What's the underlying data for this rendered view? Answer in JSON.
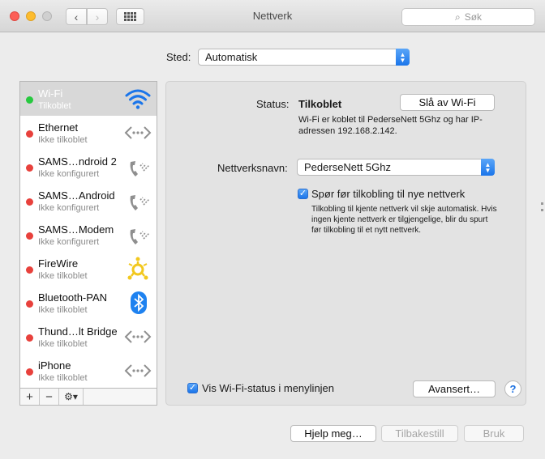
{
  "window": {
    "title": "Nettverk"
  },
  "toolbar": {
    "back": "‹",
    "forward": "›",
    "search_placeholder": "Søk"
  },
  "location": {
    "label": "Sted:",
    "value": "Automatisk"
  },
  "services": [
    {
      "name": "Wi-Fi",
      "status": "Tilkoblet",
      "dot": "#27c93f",
      "icon": "wifi-icon",
      "selected": true
    },
    {
      "name": "Ethernet",
      "status": "Ikke tilkoblet",
      "dot": "#e8413c",
      "icon": "ethernet-icon"
    },
    {
      "name": "SAMS…ndroid 2",
      "status": "Ikke konfigurert",
      "dot": "#e8413c",
      "icon": "phone-icon"
    },
    {
      "name": "SAMS…Android",
      "status": "Ikke konfigurert",
      "dot": "#e8413c",
      "icon": "phone-icon"
    },
    {
      "name": "SAMS…Modem",
      "status": "Ikke konfigurert",
      "dot": "#e8413c",
      "icon": "phone-icon"
    },
    {
      "name": "FireWire",
      "status": "Ikke tilkoblet",
      "dot": "#e8413c",
      "icon": "firewire-icon"
    },
    {
      "name": "Bluetooth-PAN",
      "status": "Ikke tilkoblet",
      "dot": "#e8413c",
      "icon": "bluetooth-icon"
    },
    {
      "name": "Thund…lt Bridge",
      "status": "Ikke tilkoblet",
      "dot": "#e8413c",
      "icon": "ethernet-icon"
    },
    {
      "name": "iPhone",
      "status": "Ikke tilkoblet",
      "dot": "#e8413c",
      "icon": "ethernet-icon"
    }
  ],
  "sidebar_buttons": {
    "add": "+",
    "remove": "−",
    "gear": "⚙▾"
  },
  "detail": {
    "status_label": "Status:",
    "status_value": "Tilkoblet",
    "wifi_off_button": "Slå av Wi-Fi",
    "status_desc": "Wi-Fi er koblet til PederseNett 5Ghz og har IP-adressen 192.168.2.142.",
    "network_name_label": "Nettverksnavn:",
    "network_name_value": "PederseNett 5Ghz",
    "ask_label": "Spør før tilkobling til nye nettverk",
    "ask_checked": true,
    "ask_desc": "Tilkobling til kjente nettverk vil skje automatisk. Hvis ingen kjente nettverk er tilgjengelige, blir du spurt før tilkobling til et nytt nettverk.",
    "show_status_label": "Vis Wi-Fi-status i menylinjen",
    "show_status_checked": true,
    "advanced_button": "Avansert…",
    "help_button": "?"
  },
  "footer": {
    "help": "Hjelp meg…",
    "reset": "Tilbakestill",
    "apply": "Bruk"
  },
  "colors": {
    "accent": "#1a75ea",
    "wifi_blue": "#1a75ea",
    "bluetooth_blue": "#1e82f0",
    "firewire_yellow": "#f2c81e"
  }
}
